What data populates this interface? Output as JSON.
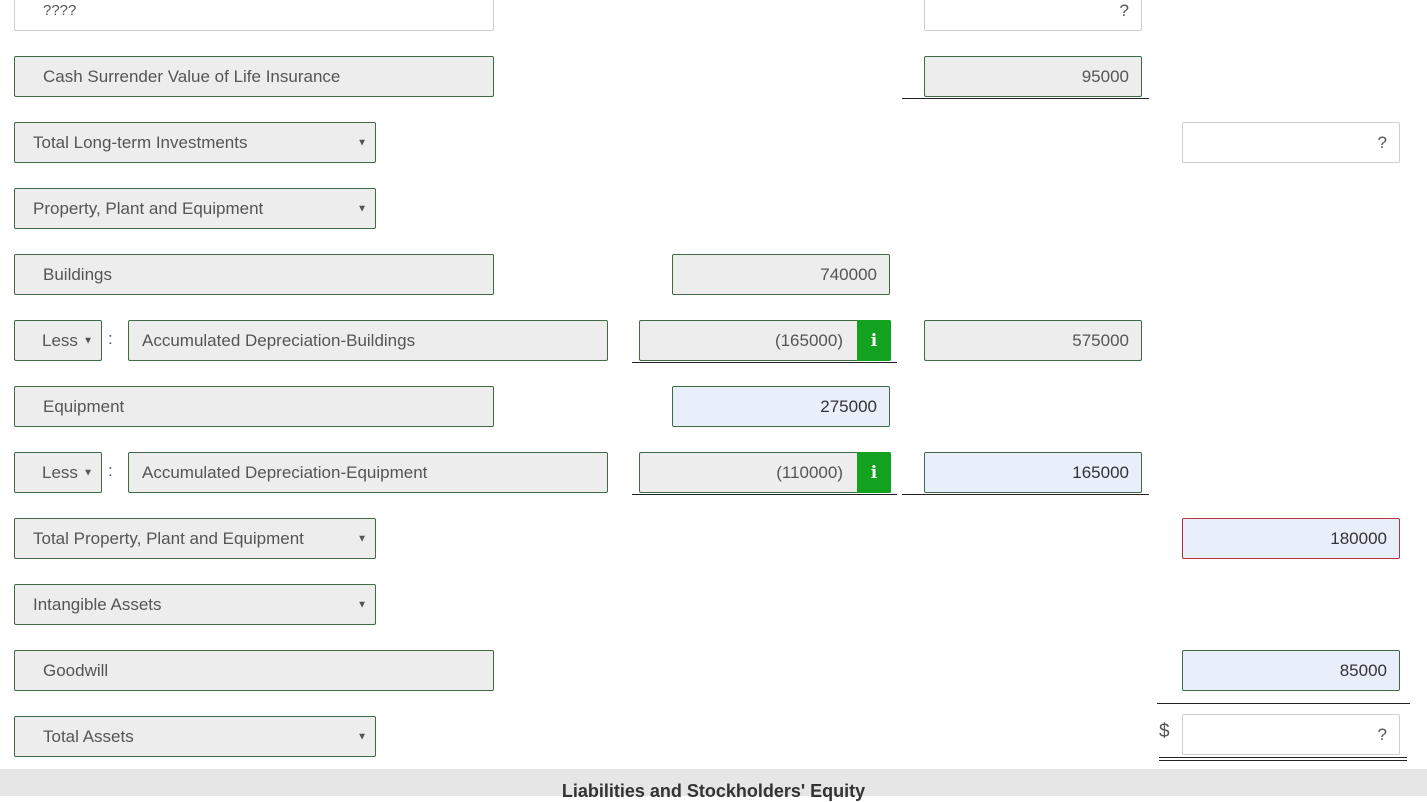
{
  "rows": {
    "prev_row": {
      "label": "????",
      "amount_col3": "?"
    },
    "cash_surrender": {
      "label": "Cash Surrender Value of Life Insurance",
      "amount_col3": "95000"
    },
    "total_lt_investments": {
      "label": "Total Long-term Investments",
      "amount_col4": "?"
    },
    "ppe_header": {
      "label": "Property, Plant and Equipment"
    },
    "buildings": {
      "label": "Buildings",
      "amount_col2": "740000"
    },
    "accum_dep_buildings": {
      "prefix": "Less",
      "separator": ":",
      "label": "Accumulated Depreciation-Buildings",
      "amount_col2": "(165000)",
      "amount_col3": "575000"
    },
    "equipment": {
      "label": "Equipment",
      "amount_col2": "275000"
    },
    "accum_dep_equipment": {
      "prefix": "Less",
      "separator": ":",
      "label": "Accumulated Depreciation-Equipment",
      "amount_col2": "(110000)",
      "amount_col3": "165000"
    },
    "total_ppe": {
      "label": "Total Property, Plant and Equipment",
      "amount_col4": "180000"
    },
    "intangible_header": {
      "label": "Intangible Assets"
    },
    "goodwill": {
      "label": "Goodwill",
      "amount_col4": "85000"
    },
    "total_assets": {
      "label": "Total Assets",
      "currency": "$",
      "amount_col4": "?"
    }
  },
  "icons": {
    "info": "i",
    "caret": "▼"
  },
  "section": {
    "title": "Liabilities and Stockholders' Equity"
  },
  "colors": {
    "field_border": "#3e6b45",
    "field_bg": "#ededed",
    "edited_bg": "#e8effb",
    "error_border": "#b5333f",
    "info_button": "#12a21f"
  }
}
